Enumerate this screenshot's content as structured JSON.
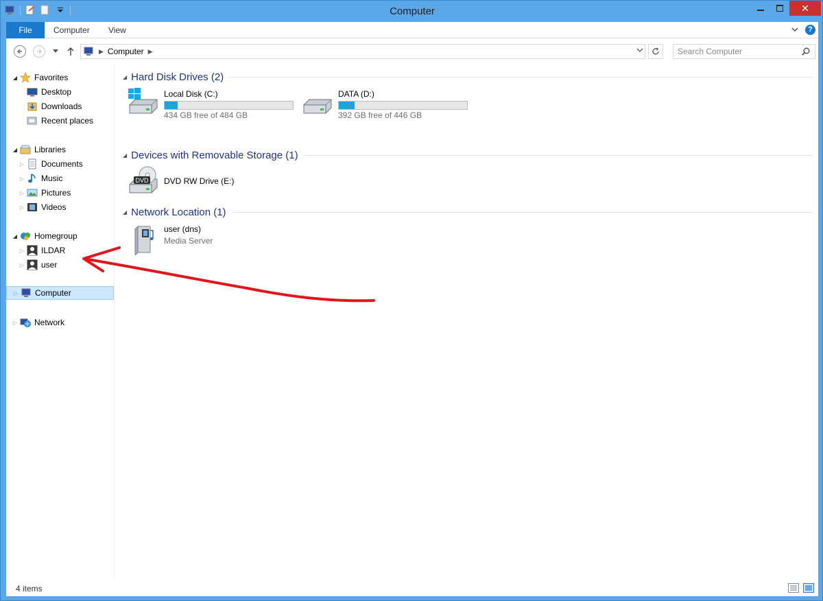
{
  "window": {
    "title": "Computer",
    "close_glyph": "✕"
  },
  "ribbon": {
    "tabs": [
      {
        "label": "File"
      },
      {
        "label": "Computer"
      },
      {
        "label": "View"
      }
    ],
    "help_glyph": "?"
  },
  "address": {
    "crumbs": [
      "Computer"
    ],
    "search_placeholder": "Search Computer"
  },
  "sidebar": {
    "favorites": {
      "label": "Favorites",
      "items": [
        "Desktop",
        "Downloads",
        "Recent places"
      ]
    },
    "libraries": {
      "label": "Libraries",
      "items": [
        "Documents",
        "Music",
        "Pictures",
        "Videos"
      ]
    },
    "homegroup": {
      "label": "Homegroup",
      "items": [
        "ILDAR",
        "user"
      ]
    },
    "computer": {
      "label": "Computer"
    },
    "network": {
      "label": "Network"
    }
  },
  "content": {
    "groups": [
      {
        "title": "Hard Disk Drives (2)",
        "items": [
          {
            "name": "Local Disk (C:)",
            "free_text": "434 GB free of 484 GB",
            "used_fraction": 0.103,
            "icon": "windows-drive-icon"
          },
          {
            "name": "DATA (D:)",
            "free_text": "392 GB free of 446 GB",
            "used_fraction": 0.121,
            "icon": "hard-drive-icon"
          }
        ]
      },
      {
        "title": "Devices with Removable Storage (1)",
        "items": [
          {
            "name": "DVD RW Drive (E:)",
            "icon": "dvd-drive-icon",
            "badge": "DVD"
          }
        ]
      },
      {
        "title": "Network Location (1)",
        "items": [
          {
            "name": "user (dns)",
            "subtitle": "Media Server",
            "icon": "media-server-icon"
          }
        ]
      }
    ]
  },
  "status": {
    "item_count": "4 items"
  },
  "colors": {
    "accent": "#1979ca",
    "bar_fill": "#26a0da",
    "group_title": "#1e3287",
    "annotation": "#e0161c"
  }
}
